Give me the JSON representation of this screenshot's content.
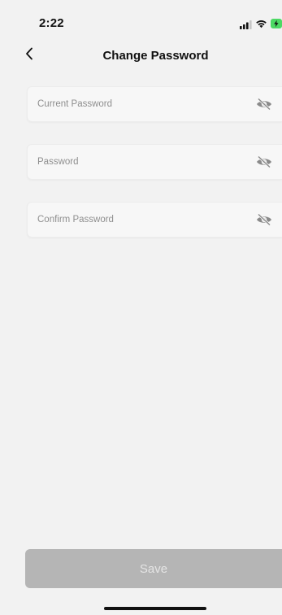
{
  "status_bar": {
    "time": "2:22",
    "icons": [
      "signal-icon",
      "wifi-icon",
      "battery-charging-icon"
    ],
    "battery_color": "#4cd964"
  },
  "nav": {
    "back_icon": "chevron-left-icon",
    "title": "Change Password"
  },
  "form": {
    "fields": [
      {
        "placeholder": "Current Password",
        "value": "",
        "toggle_icon": "eye-slash-icon"
      },
      {
        "placeholder": "Password",
        "value": "",
        "toggle_icon": "eye-slash-icon"
      },
      {
        "placeholder": "Confirm Password",
        "value": "",
        "toggle_icon": "eye-slash-icon"
      }
    ]
  },
  "actions": {
    "save_label": "Save",
    "save_state": "disabled"
  },
  "colors": {
    "background": "#f2f2f2",
    "field_background": "#f7f7f7",
    "button_disabled": "#b5b5b5",
    "button_text_disabled": "#e5e5e5"
  }
}
